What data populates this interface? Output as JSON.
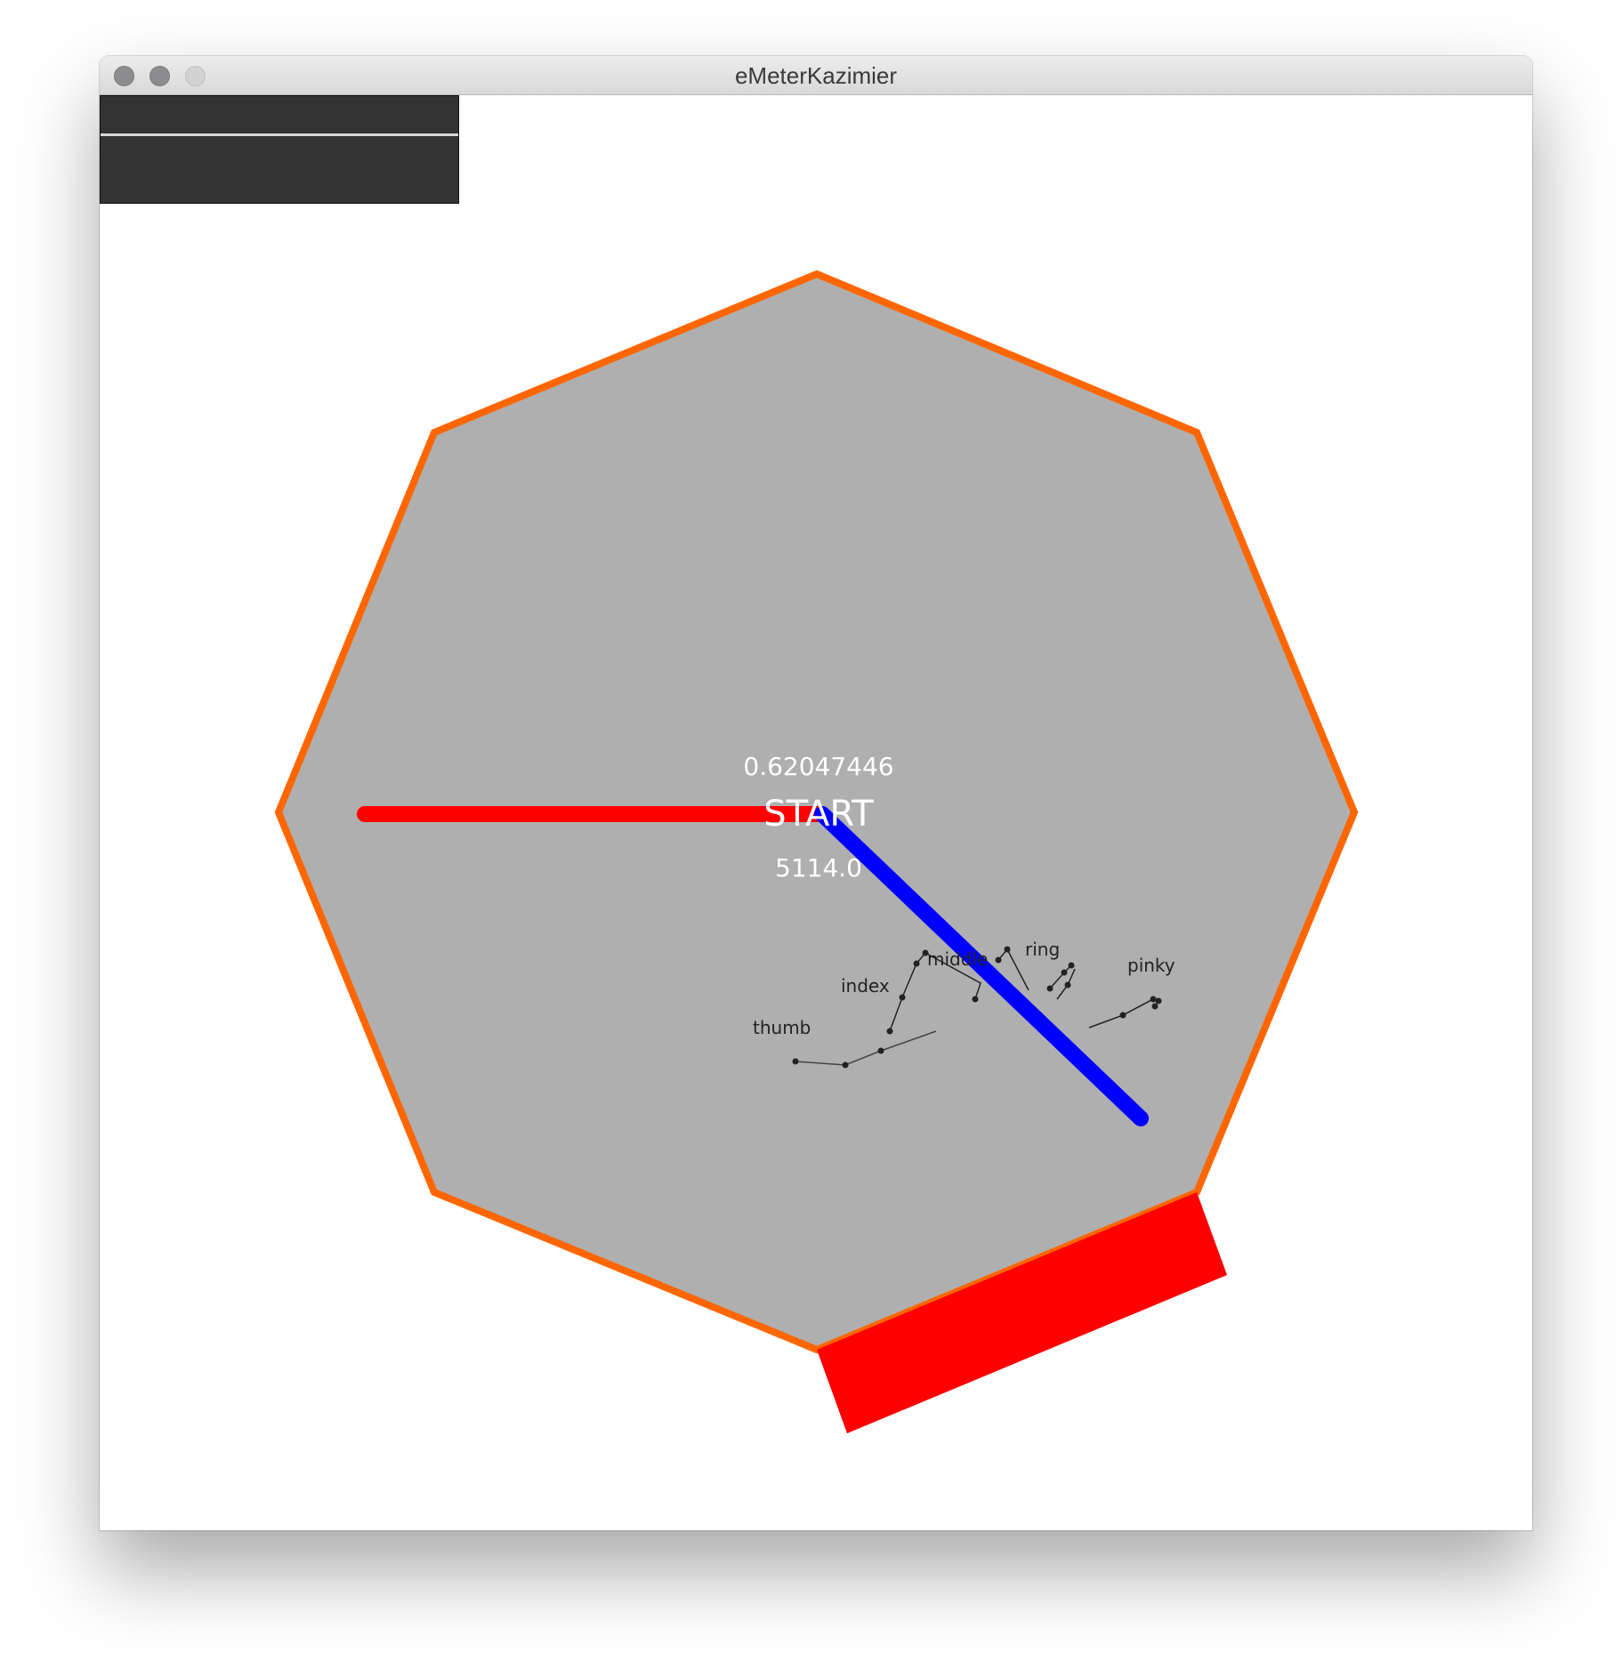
{
  "window": {
    "title": "eMeterKazimier"
  },
  "meter": {
    "value_top": "0.62047446",
    "label_center": "START",
    "value_bottom": "5114.0"
  },
  "hand": {
    "fingers": [
      "thumb",
      "index",
      "middle",
      "ring",
      "pinky"
    ]
  },
  "colors": {
    "octagon_fill": "#afafaf",
    "octagon_stroke": "#ff6600",
    "red_needle": "#ff0000",
    "blue_needle": "#0000ff",
    "red_bar": "#ff0000",
    "top_panel": "#333333"
  }
}
